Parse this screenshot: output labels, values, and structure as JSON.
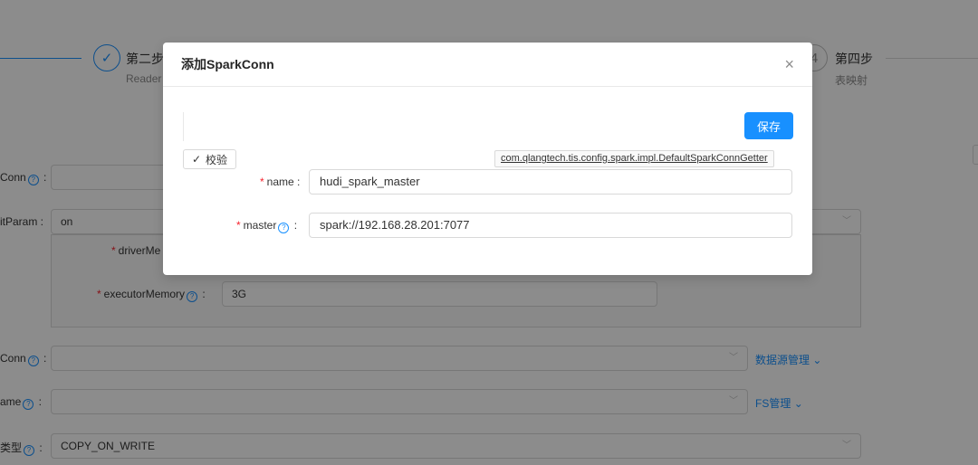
{
  "steps": [
    {
      "index": "✓",
      "title": "第二步",
      "desc": "Reader"
    },
    {
      "index": "4",
      "title": "第四步",
      "desc": "表映射"
    }
  ],
  "form": {
    "conn_label": "Conn",
    "initparam_label": "itParam",
    "initparam_value": "on",
    "driver_memory_label": "driverMe",
    "executor_memory_label": "executorMemory",
    "executor_memory_value": "3G",
    "datasource_conn_label": "Conn",
    "datasource_manage_link": "数据源管理",
    "fs_name_label": "ame",
    "fs_manage_link": "FS管理",
    "table_type_label": "类型",
    "table_type_value": "COPY_ON_WRITE"
  },
  "modal": {
    "title": "添加SparkConn",
    "close": "×",
    "save_label": "保存",
    "verify_label": "校验",
    "impl_class": "com.qlangtech.tis.config.spark.impl.DefaultSparkConnGetter",
    "name_label": "name",
    "name_value": "hudi_spark_master",
    "master_label": "master",
    "master_value": "spark://192.168.28.201:7077"
  },
  "colors": {
    "accent": "#1890ff",
    "required": "#f5222d",
    "mask": "rgba(0,0,0,0.45)"
  }
}
